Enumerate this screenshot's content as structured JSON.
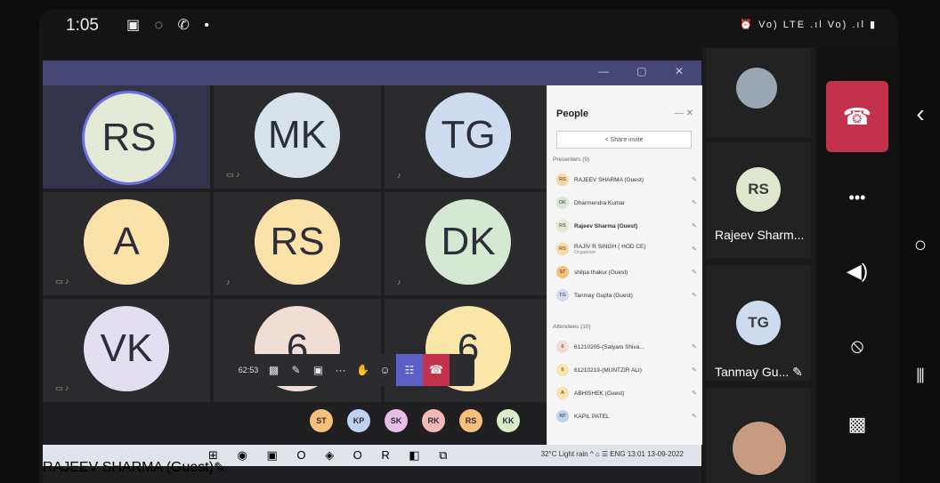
{
  "status": {
    "time": "1:05",
    "left_icons": "▣ ◌ ✆ •",
    "right_icons": "⏰ Vo) LTE .ıl Vo) .ıl ▮"
  },
  "tiles": [
    {
      "initials": "RS",
      "color": "#e4ead5"
    },
    {
      "initials": "MK",
      "color": "#d7e2ea"
    },
    {
      "initials": "TG",
      "color": "#cfdcef"
    },
    {
      "initials": "A",
      "color": "#fbe2a8"
    },
    {
      "initials": "RS",
      "color": "#fbe2a8"
    },
    {
      "initials": "DK",
      "color": "#d5e8d4"
    },
    {
      "initials": "VK",
      "color": "#e3def0"
    },
    {
      "initials": "6",
      "color": "#f0ddd4"
    },
    {
      "initials": "6",
      "color": "#fbe6a9"
    }
  ],
  "call_toolbar": {
    "timer": "62:53",
    "camera_icon": "video-off-icon",
    "mic_icon": "mic-off-icon",
    "share_icon": "share-icon",
    "more": "···",
    "raise_icon": "hand-icon",
    "react_icon": "react-icon",
    "people_icon": "people-icon",
    "hangup_icon": "hangup-icon"
  },
  "mini_avatars": [
    {
      "initials": "ST",
      "color": "#f7c07a"
    },
    {
      "initials": "KP",
      "color": "#bfd2f0"
    },
    {
      "initials": "SK",
      "color": "#e8bde6"
    },
    {
      "initials": "RK",
      "color": "#f3b9b9"
    },
    {
      "initials": "RS",
      "color": "#f7c07a"
    },
    {
      "initials": "KK",
      "color": "#d8ecc8"
    }
  ],
  "panel": {
    "title": "People",
    "close": "— ✕",
    "invite": "< Share invite",
    "presenters_label": "Presenters (9)",
    "presenters": [
      {
        "initials": "RS",
        "color": "#fbd8a0",
        "name": "RAJEEV SHARMA (Guest)",
        "bold": false,
        "sub": ""
      },
      {
        "initials": "DK",
        "color": "#d5e8d4",
        "name": "Dharmendra Kumar",
        "bold": false,
        "sub": ""
      },
      {
        "initials": "RS",
        "color": "#e4ead5",
        "name": "Rajeev Sharma (Guest)",
        "bold": true,
        "sub": ""
      },
      {
        "initials": "RS",
        "color": "#fbd8a0",
        "name": "RAJIV R SINGH ( HOD CE)",
        "bold": false,
        "sub": "Organizer"
      },
      {
        "initials": "ST",
        "color": "#f7c07a",
        "name": "shilpa thakur (Guest)",
        "bold": false,
        "sub": ""
      },
      {
        "initials": "TG",
        "color": "#cfdcef",
        "name": "Tanmay Gupta (Guest)",
        "bold": false,
        "sub": ""
      }
    ],
    "attendees_label": "Attendees (10)",
    "attendees": [
      {
        "initials": "6",
        "color": "#f0ddd4",
        "name": "61210205-(Satyam Shiva...",
        "bold": false,
        "sub": ""
      },
      {
        "initials": "6",
        "color": "#fbe6a9",
        "name": "61210219-(MUNTZIR ALI)",
        "bold": false,
        "sub": ""
      },
      {
        "initials": "A",
        "color": "#fbe2a8",
        "name": "ABHISHEK (Guest)",
        "bold": false,
        "sub": ""
      },
      {
        "initials": "KP",
        "color": "#bfd2f0",
        "name": "KAPIL PATEL",
        "bold": false,
        "sub": ""
      }
    ]
  },
  "taskbar": {
    "presenter_name": "RAJEEV SHARMA (Guest)",
    "apps": "⊞ ◉ ▣ O ◈ O R ◧ ⧉",
    "tray": "32°C Light rain ^ ⌂ ☰ ENG 13:01 13-09-2022"
  },
  "right_panel": [
    {
      "name": "",
      "initials": "",
      "photo": true
    },
    {
      "name": "Rajeev Sharm...",
      "initials": "RS",
      "photo": false
    },
    {
      "name": "Tanmay Gu...",
      "initials": "TG",
      "photo": false
    },
    {
      "name": "",
      "initials": "",
      "photo": true
    }
  ],
  "controls": {
    "end_icon": "hangup-icon",
    "more": "•••",
    "speaker_icon": "speaker-icon",
    "mic_icon": "mic-off-icon",
    "video_icon": "video-off-icon"
  },
  "nav": {
    "back": "‹",
    "home": "○",
    "recents": "⦀"
  }
}
